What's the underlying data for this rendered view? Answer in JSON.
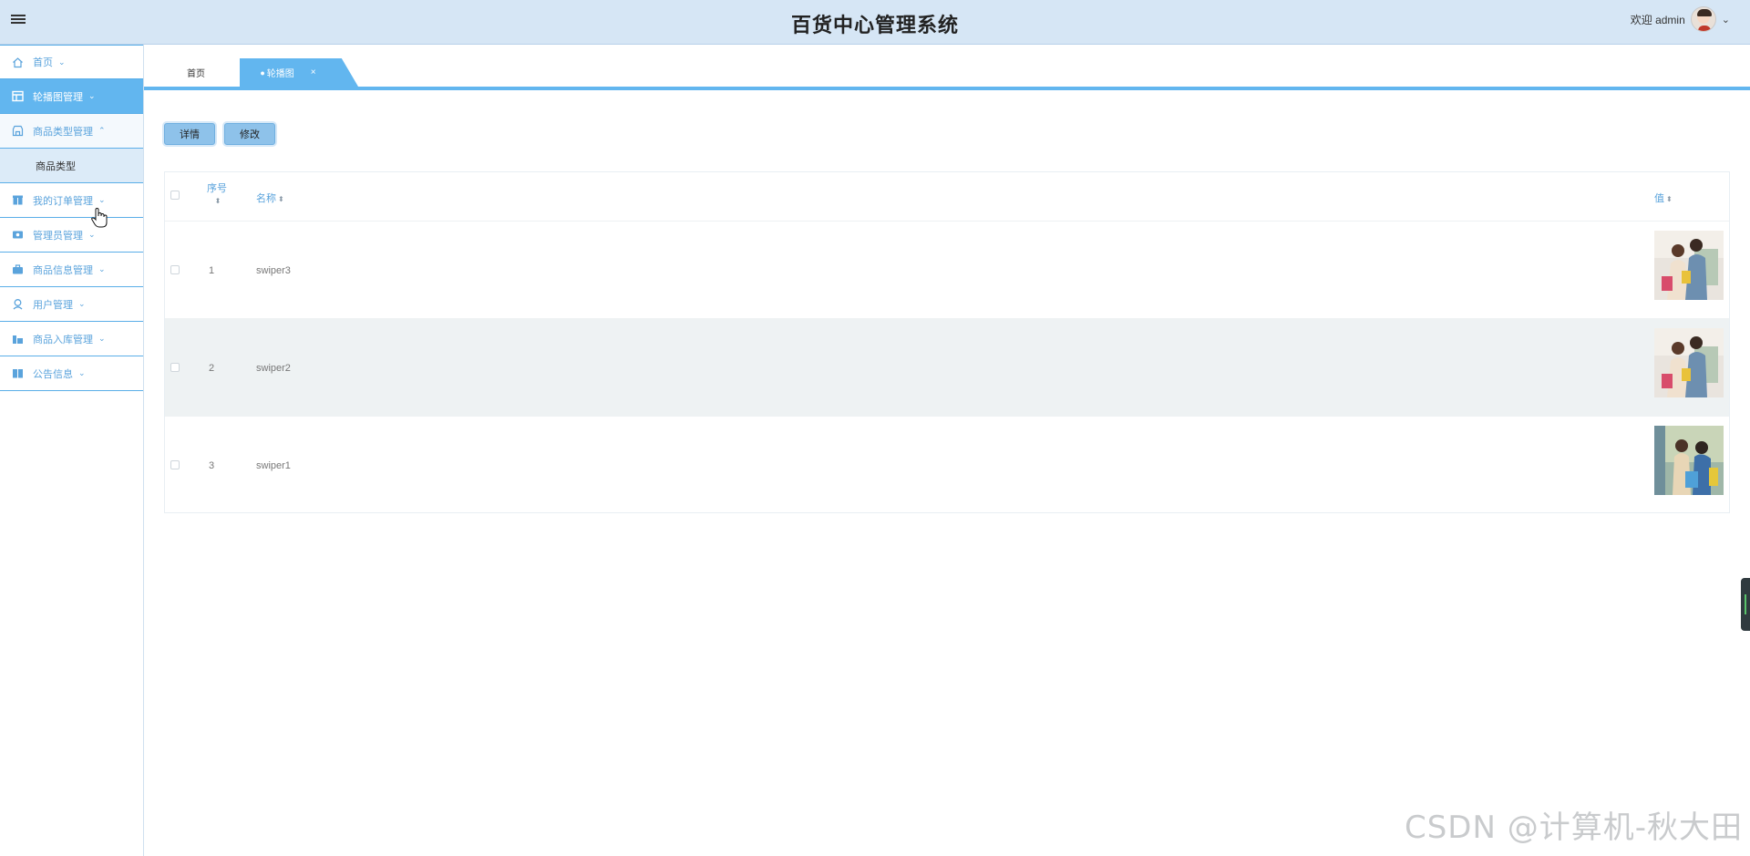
{
  "header": {
    "title": "百货中心管理系统",
    "welcome": "欢迎 admin",
    "user_caret": "⌄"
  },
  "sidebar": {
    "items": [
      {
        "label": "首页",
        "icon": "home-icon"
      },
      {
        "label": "轮播图管理",
        "icon": "layout-icon"
      },
      {
        "label": "商品类型管理",
        "icon": "shop-icon"
      },
      {
        "label": "我的订单管理",
        "icon": "order-icon"
      },
      {
        "label": "管理员管理",
        "icon": "admin-icon"
      },
      {
        "label": "商品信息管理",
        "icon": "briefcase-icon"
      },
      {
        "label": "用户管理",
        "icon": "user-icon"
      },
      {
        "label": "商品入库管理",
        "icon": "warehouse-icon"
      },
      {
        "label": "公告信息",
        "icon": "notice-icon"
      }
    ],
    "submenu": {
      "label": "商品类型"
    }
  },
  "tabs": {
    "home": "首页",
    "current": "轮播图",
    "current_dot": "●",
    "close": "×"
  },
  "toolbar": {
    "detail_label": "详情",
    "edit_label": "修改"
  },
  "table": {
    "headers": {
      "index": "序号",
      "name": "名称",
      "value": "值"
    },
    "rows": [
      {
        "index": "1",
        "name": "swiper3"
      },
      {
        "index": "2",
        "name": "swiper2"
      },
      {
        "index": "3",
        "name": "swiper1"
      }
    ]
  },
  "watermark": "CSDN @计算机-秋大田",
  "colors": {
    "header_bg": "#d6e6f5",
    "accent": "#62b6ef",
    "sidebar_text": "#5aa3dc",
    "button_bg": "#8ec2ea"
  }
}
